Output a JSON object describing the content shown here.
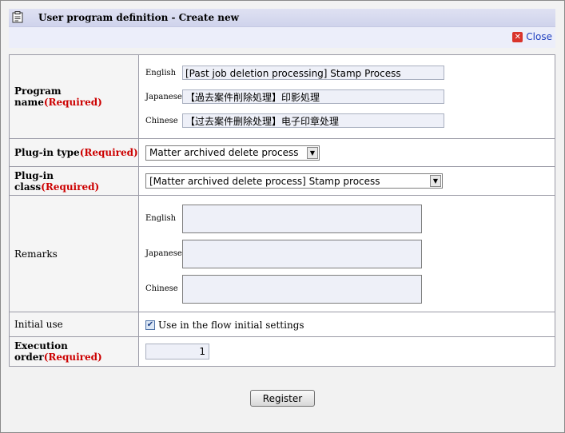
{
  "dialog": {
    "title": "User program definition - Create new",
    "close_label": "Close"
  },
  "program_name": {
    "label": "Program name",
    "required": "(Required)",
    "rows": [
      {
        "lang": "English",
        "value": "[Past job deletion processing] Stamp Process"
      },
      {
        "lang": "Japanese",
        "value": "【過去案件削除処理】印影処理"
      },
      {
        "lang": "Chinese",
        "value": "【过去案件删除处理】电子印章处理"
      }
    ]
  },
  "plugin_type": {
    "label": "Plug-in type",
    "required": "(Required)",
    "selected": "Matter archived delete process"
  },
  "plugin_class": {
    "label": "Plug-in class",
    "required": "(Required)",
    "selected": "[Matter archived delete process] Stamp process"
  },
  "remarks": {
    "label": "Remarks",
    "rows": [
      {
        "lang": "English",
        "value": ""
      },
      {
        "lang": "Japanese",
        "value": ""
      },
      {
        "lang": "Chinese",
        "value": ""
      }
    ]
  },
  "initial_use": {
    "label": "Initial use",
    "checkbox_label": "Use in the flow initial settings",
    "checked": true
  },
  "execution_order": {
    "label": "Execution order",
    "required": "(Required)",
    "value": "1"
  },
  "register_label": "Register"
}
